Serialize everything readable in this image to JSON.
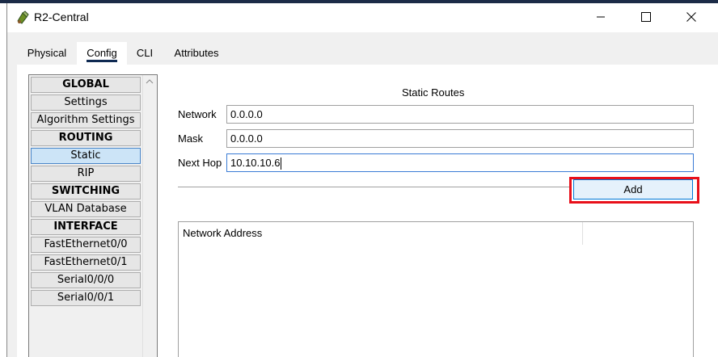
{
  "window": {
    "title": "R2-Central",
    "icon": "router-device-icon",
    "controls": [
      "minimize-icon",
      "maximize-icon",
      "close-icon"
    ]
  },
  "tabs": [
    {
      "label": "Physical",
      "active": false
    },
    {
      "label": "Config",
      "active": true
    },
    {
      "label": "CLI",
      "active": false
    },
    {
      "label": "Attributes",
      "active": false
    }
  ],
  "sidebar": {
    "items": [
      {
        "label": "GLOBAL",
        "header": true
      },
      {
        "label": "Settings",
        "header": false
      },
      {
        "label": "Algorithm Settings",
        "header": false
      },
      {
        "label": "ROUTING",
        "header": true
      },
      {
        "label": "Static",
        "header": false,
        "selected": true
      },
      {
        "label": "RIP",
        "header": false
      },
      {
        "label": "SWITCHING",
        "header": true
      },
      {
        "label": "VLAN Database",
        "header": false
      },
      {
        "label": "INTERFACE",
        "header": true
      },
      {
        "label": "FastEthernet0/0",
        "header": false
      },
      {
        "label": "FastEthernet0/1",
        "header": false
      },
      {
        "label": "Serial0/0/0",
        "header": false
      },
      {
        "label": "Serial0/0/1",
        "header": false
      }
    ]
  },
  "static_routes": {
    "title": "Static Routes",
    "network_label": "Network",
    "network_value": "0.0.0.0",
    "mask_label": "Mask",
    "mask_value": "0.0.0.0",
    "next_hop_label": "Next Hop",
    "next_hop_value": "10.10.10.6",
    "add_label": "Add",
    "table_header": "Network Address"
  },
  "colors": {
    "highlight": "#e8101a",
    "selected": "#cce4f7",
    "active_tab_underline": "#0f2a52"
  }
}
